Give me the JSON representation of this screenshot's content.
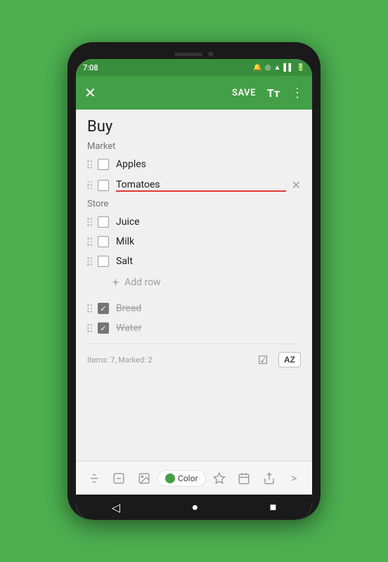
{
  "statusBar": {
    "time": "7:08",
    "icons": [
      "notification1",
      "notification2",
      "wifi",
      "signal",
      "battery"
    ]
  },
  "topBar": {
    "closeLabel": "✕",
    "saveLabel": "SAVE",
    "fontLabel": "Tт",
    "moreLabel": "⋮"
  },
  "note": {
    "title": "Buy"
  },
  "sections": [
    {
      "id": "market",
      "label": "Market",
      "items": [
        {
          "id": "apples",
          "text": "Apples",
          "checked": false,
          "editing": false
        },
        {
          "id": "tomatoes",
          "text": "Tomatoes",
          "checked": false,
          "editing": true,
          "deletable": true
        }
      ]
    },
    {
      "id": "store",
      "label": "Store",
      "items": [
        {
          "id": "juice",
          "text": "Juice",
          "checked": false,
          "editing": false
        },
        {
          "id": "milk",
          "text": "Milk",
          "checked": false,
          "editing": false
        },
        {
          "id": "salt",
          "text": "Salt",
          "checked": false,
          "editing": false
        }
      ]
    }
  ],
  "addRow": {
    "label": "Add row"
  },
  "checkedItems": [
    {
      "id": "bread",
      "text": "Bread",
      "checked": true
    },
    {
      "id": "water",
      "text": "Water",
      "checked": true
    }
  ],
  "itemsStatus": {
    "label": "Items: 7, Marked: 2"
  },
  "bottomToolbar": {
    "colorLabel": "Color",
    "moreLabel": ">"
  },
  "navBar": {
    "backLabel": "◁",
    "homeLabel": "●",
    "recentLabel": "■"
  }
}
